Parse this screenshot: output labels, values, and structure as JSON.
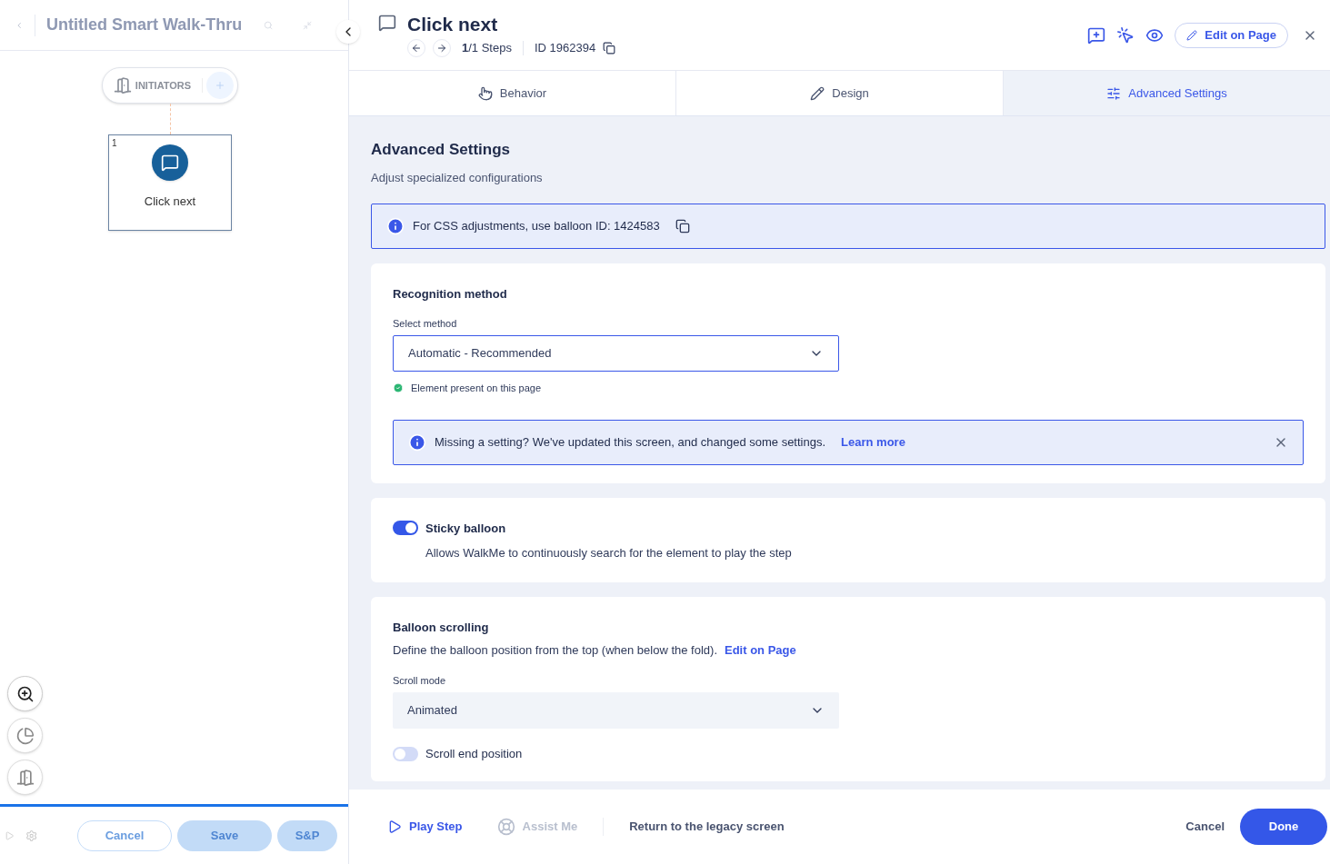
{
  "left_panel": {
    "title": "Untitled Smart Walk-Thru",
    "initiators_label": "INITIATORS",
    "step": {
      "number": "1",
      "label": "Click next"
    },
    "buttons": [
      {
        "label": "Cancel",
        "kind": "outline",
        "disabled": true
      },
      {
        "label": "Save",
        "kind": "solid",
        "disabled": true
      },
      {
        "label": "S&P",
        "kind": "solid",
        "disabled": true
      }
    ]
  },
  "header": {
    "title": "Click next",
    "steps": "**1**/1 Steps",
    "id": "ID 1962394",
    "edit_button": "Edit on Page"
  },
  "tabs": [
    {
      "label": "Behavior",
      "selected": false,
      "kind": "behavior"
    },
    {
      "label": "Design",
      "selected": false,
      "kind": "design"
    },
    {
      "label": "Advanced Settings",
      "selected": true,
      "kind": "advanced"
    }
  ],
  "section": {
    "title": "Advanced Settings",
    "subtitle": "Adjust specialized configurations",
    "css_note": "For CSS adjustments, use balloon ID: 1424583"
  },
  "recognition": {
    "title": "Recognition method",
    "field_label": "Select method",
    "value": "Automatic - Recommended",
    "status": "Element present on this page",
    "notice": {
      "text": "Missing a setting? We've updated this screen, and changed some settings.",
      "link": "Learn more"
    }
  },
  "sticky": {
    "label": "Sticky balloon",
    "description": "Allows WalkMe to continuously search for the element to play the step",
    "on": true
  },
  "scrolling": {
    "title": "Balloon scrolling",
    "description": "Define the balloon position from the top (when below the fold).",
    "link": "Edit on Page",
    "field_label": "Scroll mode",
    "value": "Animated",
    "toggle": {
      "label": "Scroll end position",
      "on": false
    }
  },
  "footer": {
    "play": "Play Step",
    "assist": {
      "label": "Assist Me",
      "disabled": true
    },
    "legacy": "Return to the legacy screen",
    "cancel": "Cancel",
    "done": "Done"
  }
}
